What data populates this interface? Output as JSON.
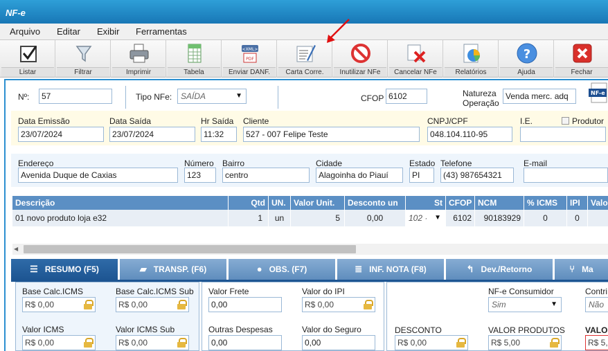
{
  "window": {
    "title": "NF-e"
  },
  "menu": [
    "Arquivo",
    "Editar",
    "Exibir",
    "Ferramentas"
  ],
  "toolbar": [
    {
      "label": "Listar",
      "icon": "checkbox-icon"
    },
    {
      "label": "Filtrar",
      "icon": "filter-icon"
    },
    {
      "label": "Imprimir",
      "icon": "printer-icon"
    },
    {
      "label": "Tabela",
      "icon": "spreadsheet-icon"
    },
    {
      "label": "Enviar DANF.",
      "icon": "xml-pdf-icon"
    },
    {
      "label": "Carta Corre.",
      "icon": "document-pen-icon"
    },
    {
      "label": "Inutilizar NFe",
      "icon": "no-entry-icon"
    },
    {
      "label": "Cancelar NFe",
      "icon": "cancel-document-icon"
    },
    {
      "label": "Relatórios",
      "icon": "pie-chart-icon"
    },
    {
      "label": "Ajuda",
      "icon": "help-icon"
    },
    {
      "label": "Fechar",
      "icon": "close-icon"
    }
  ],
  "header": {
    "numero_label": "Nº:",
    "numero_value": "57",
    "tipo_label": "Tipo NFe:",
    "tipo_value": "SAÍDA",
    "cfop_label": "CFOP",
    "cfop_value": "6102",
    "natureza_label_1": "Natureza",
    "natureza_label_2": "Operação",
    "natureza_value": "Venda merc. adq",
    "logo_text": "NF-e"
  },
  "cliente": {
    "data_emissao_label": "Data Emissão",
    "data_emissao": "23/07/2024",
    "data_saida_label": "Data Saída",
    "data_saida": "23/07/2024",
    "hr_saida_label": "Hr Saída",
    "hr_saida": "11:32",
    "cliente_label": "Cliente",
    "cliente": "527 - 007 Felipe Teste",
    "cnpj_label": "CNPJ/CPF",
    "cnpj": "048.104.110-95",
    "ie_label": "I.E.",
    "ie": "",
    "produtor_label": "Produtor"
  },
  "endereco": {
    "endereco_label": "Endereço",
    "endereco": "Avenida Duque de Caxias",
    "numero_label": "Número",
    "numero": "123",
    "bairro_label": "Bairro",
    "bairro": "centro",
    "cidade_label": "Cidade",
    "cidade": "Alagoinha do Piauí",
    "estado_label": "Estado",
    "estado": "PI",
    "telefone_label": "Telefone",
    "telefone": "(43) 987654321",
    "email_label": "E-mail",
    "email": ""
  },
  "items_table": {
    "columns": [
      "Descrição",
      "Qtd",
      "UN.",
      "Valor Unit.",
      "Desconto un",
      "St",
      "CFOP",
      "NCM",
      "% ICMS",
      "IPI",
      "Valo"
    ],
    "rows": [
      [
        "01 novo produto loja e32",
        "1",
        "un",
        "5",
        "0,00",
        "102 ·",
        "6102",
        "90183929",
        "0",
        "0",
        ""
      ]
    ]
  },
  "tabs": [
    {
      "label": "RESUMO (F5)",
      "icon": "list-icon",
      "active": true
    },
    {
      "label": "TRANSP. (F6)",
      "icon": "truck-icon",
      "active": false
    },
    {
      "label": "OBS. (F7)",
      "icon": "chat-icon",
      "active": false
    },
    {
      "label": "INF. NOTA (F8)",
      "icon": "database-icon",
      "active": false
    },
    {
      "label": "Dev./Retorno",
      "icon": "return-arrow-icon",
      "active": false
    },
    {
      "label": "Ma",
      "icon": "fork-icon",
      "active": false
    }
  ],
  "resumo": {
    "base_icms_label": "Base Calc.ICMS",
    "base_icms": "R$ 0,00",
    "base_icms_sub_label": "Base Calc.ICMS Sub",
    "base_icms_sub": "R$ 0,00",
    "valor_icms_label": "Valor ICMS",
    "valor_icms": "R$ 0,00",
    "valor_icms_sub_label": "Valor ICMS Sub",
    "valor_icms_sub": "R$ 0,00",
    "valor_frete_label": "Valor Frete",
    "valor_frete": "0,00",
    "valor_ipi_label": "Valor do IPI",
    "valor_ipi": "R$ 0,00",
    "outras_label": "Outras Despesas",
    "outras": "0,00",
    "seguro_label": "Valor do Seguro",
    "seguro": "0,00",
    "consumidor_label": "NF-e Consumidor",
    "consumidor": "Sim",
    "contri_label": "Contri",
    "contri": "Não",
    "desconto_label": "DESCONTO",
    "desconto": "R$ 0,00",
    "valor_produtos_label": "VALOR PRODUTOS",
    "valor_produtos": "R$ 5,00",
    "valor_total_label": "VALO",
    "valor_total": "R$ 5,"
  },
  "colors": {
    "accent": "#2b8fd0",
    "tab_active": "#1d5592",
    "tab": "#6f98c6",
    "table_header": "#5b8fc4",
    "highlight_band": "#fffbe6"
  }
}
